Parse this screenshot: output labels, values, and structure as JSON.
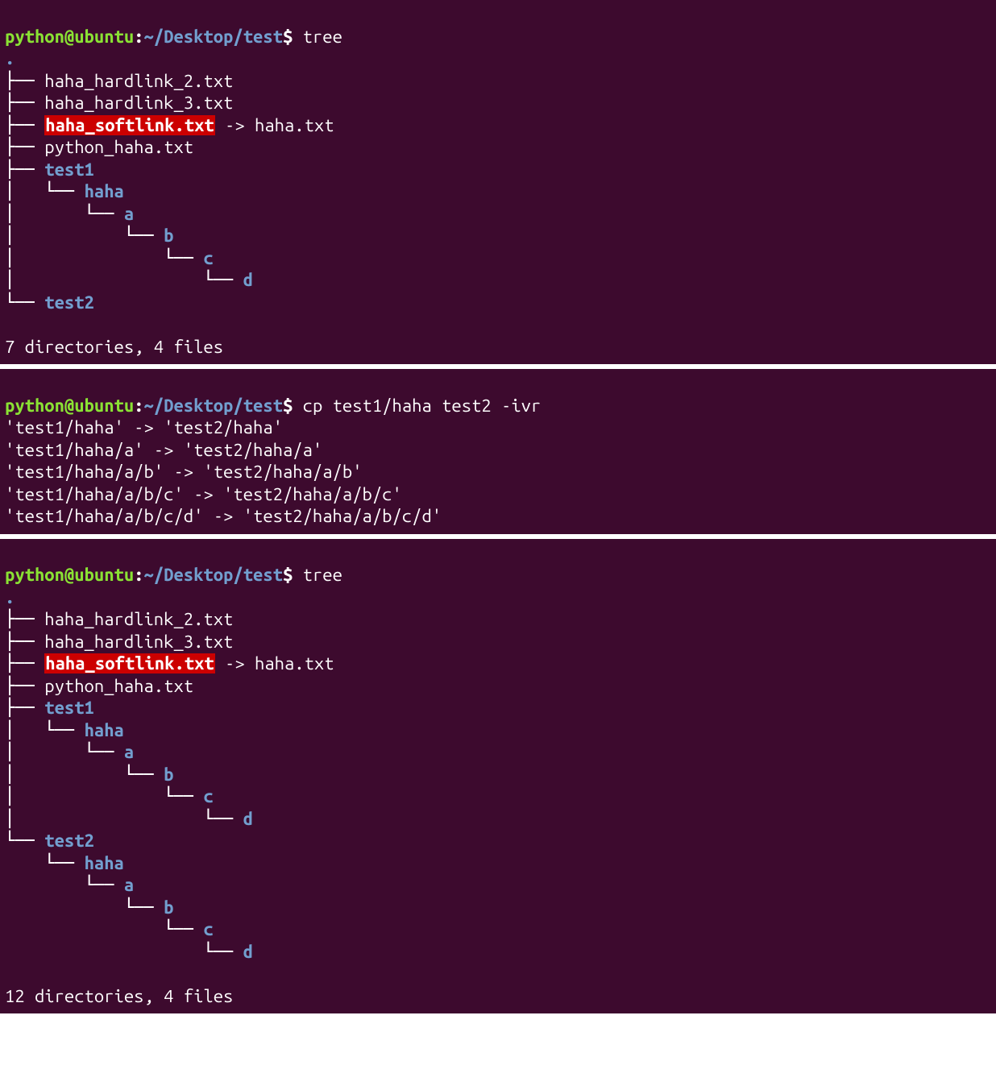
{
  "prompt": {
    "user_host": "python@ubuntu",
    "colon": ":",
    "path": "~/Desktop/test",
    "dollar": "$"
  },
  "block1": {
    "command": " tree",
    "root": ".",
    "files": {
      "f1": "haha_hardlink_2.txt",
      "f2": "haha_hardlink_3.txt",
      "f3_link": "haha_softlink.txt",
      "f3_arrow": " -> ",
      "f3_target": "haha.txt",
      "f4": "python_haha.txt",
      "d1": "test1",
      "d1_1": "haha",
      "d1_1_1": "a",
      "d1_1_1_1": "b",
      "d1_1_1_1_1": "c",
      "d1_1_1_1_1_1": "d",
      "d2": "test2"
    },
    "summary": "7 directories, 4 files"
  },
  "block2": {
    "command": " cp test1/haha test2 -ivr",
    "lines": {
      "l1": "'test1/haha' -> 'test2/haha'",
      "l2": "'test1/haha/a' -> 'test2/haha/a'",
      "l3": "'test1/haha/a/b' -> 'test2/haha/a/b'",
      "l4": "'test1/haha/a/b/c' -> 'test2/haha/a/b/c'",
      "l5": "'test1/haha/a/b/c/d' -> 'test2/haha/a/b/c/d'"
    }
  },
  "block3": {
    "command": " tree",
    "root": ".",
    "files": {
      "f1": "haha_hardlink_2.txt",
      "f2": "haha_hardlink_3.txt",
      "f3_link": "haha_softlink.txt",
      "f3_arrow": " -> ",
      "f3_target": "haha.txt",
      "f4": "python_haha.txt",
      "d1": "test1",
      "d1_1": "haha",
      "d1_1_1": "a",
      "d1_1_1_1": "b",
      "d1_1_1_1_1": "c",
      "d1_1_1_1_1_1": "d",
      "d2": "test2",
      "d2_1": "haha",
      "d2_1_1": "a",
      "d2_1_1_1": "b",
      "d2_1_1_1_1": "c",
      "d2_1_1_1_1_1": "d"
    },
    "summary": "12 directories, 4 files"
  },
  "tree_prefix": {
    "tee": "├── ",
    "last": "└── ",
    "pipe": "│   ",
    "blank": "    "
  }
}
